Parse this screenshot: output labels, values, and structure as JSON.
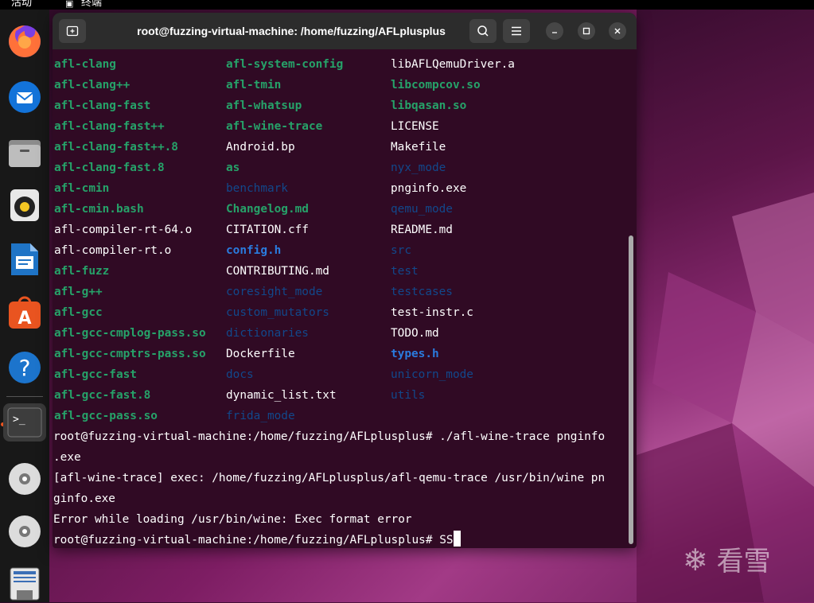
{
  "topbar": {
    "activities": "活动",
    "app_name": "终端"
  },
  "dock": {
    "items": [
      "firefox-icon",
      "thunderbird-icon",
      "files-icon",
      "rhythmbox-icon",
      "writer-icon",
      "app-center-icon",
      "help-icon",
      "terminal-icon",
      "disc-icon",
      "disc-icon",
      "save-icon"
    ]
  },
  "window": {
    "title": "root@fuzzing-virtual-machine: /home/fuzzing/AFLplusplus"
  },
  "listing": [
    [
      {
        "t": "afl-clang",
        "k": "exe"
      },
      {
        "t": "afl-system-config",
        "k": "exe"
      },
      {
        "t": "libAFLQemuDriver.a",
        "k": "plain"
      }
    ],
    [
      {
        "t": "afl-clang++",
        "k": "exe"
      },
      {
        "t": "afl-tmin",
        "k": "exe"
      },
      {
        "t": "libcompcov.so",
        "k": "exe"
      }
    ],
    [
      {
        "t": "afl-clang-fast",
        "k": "exe"
      },
      {
        "t": "afl-whatsup",
        "k": "exe"
      },
      {
        "t": "libqasan.so",
        "k": "exe"
      }
    ],
    [
      {
        "t": "afl-clang-fast++",
        "k": "exe"
      },
      {
        "t": "afl-wine-trace",
        "k": "exe"
      },
      {
        "t": "LICENSE",
        "k": "plain"
      }
    ],
    [
      {
        "t": "afl-clang-fast++.8",
        "k": "exe"
      },
      {
        "t": "Android.bp",
        "k": "plain"
      },
      {
        "t": "Makefile",
        "k": "plain"
      }
    ],
    [
      {
        "t": "afl-clang-fast.8",
        "k": "exe"
      },
      {
        "t": "as",
        "k": "exe"
      },
      {
        "t": "nyx_mode",
        "k": "dir"
      }
    ],
    [
      {
        "t": "afl-cmin",
        "k": "exe"
      },
      {
        "t": "benchmark",
        "k": "dir"
      },
      {
        "t": "pnginfo.exe",
        "k": "plain"
      }
    ],
    [
      {
        "t": "afl-cmin.bash",
        "k": "exe"
      },
      {
        "t": "Changelog.md",
        "k": "exe"
      },
      {
        "t": "qemu_mode",
        "k": "dir"
      }
    ],
    [
      {
        "t": "afl-compiler-rt-64.o",
        "k": "plain"
      },
      {
        "t": "CITATION.cff",
        "k": "plain"
      },
      {
        "t": "README.md",
        "k": "plain"
      }
    ],
    [
      {
        "t": "afl-compiler-rt.o",
        "k": "plain"
      },
      {
        "t": "config.h",
        "k": "hdr"
      },
      {
        "t": "src",
        "k": "dir"
      }
    ],
    [
      {
        "t": "afl-fuzz",
        "k": "exe"
      },
      {
        "t": "CONTRIBUTING.md",
        "k": "plain"
      },
      {
        "t": "test",
        "k": "dir"
      }
    ],
    [
      {
        "t": "afl-g++",
        "k": "exe"
      },
      {
        "t": "coresight_mode",
        "k": "dir"
      },
      {
        "t": "testcases",
        "k": "dir"
      }
    ],
    [
      {
        "t": "afl-gcc",
        "k": "exe"
      },
      {
        "t": "custom_mutators",
        "k": "dir"
      },
      {
        "t": "test-instr.c",
        "k": "plain"
      }
    ],
    [
      {
        "t": "afl-gcc-cmplog-pass.so",
        "k": "exe"
      },
      {
        "t": "dictionaries",
        "k": "dir"
      },
      {
        "t": "TODO.md",
        "k": "plain"
      }
    ],
    [
      {
        "t": "afl-gcc-cmptrs-pass.so",
        "k": "exe"
      },
      {
        "t": "Dockerfile",
        "k": "plain"
      },
      {
        "t": "types.h",
        "k": "hdr"
      }
    ],
    [
      {
        "t": "afl-gcc-fast",
        "k": "exe"
      },
      {
        "t": "docs",
        "k": "dir"
      },
      {
        "t": "unicorn_mode",
        "k": "dir"
      }
    ],
    [
      {
        "t": "afl-gcc-fast.8",
        "k": "exe"
      },
      {
        "t": "dynamic_list.txt",
        "k": "plain"
      },
      {
        "t": "utils",
        "k": "dir"
      }
    ],
    [
      {
        "t": "afl-gcc-pass.so",
        "k": "exe"
      },
      {
        "t": "frida_mode",
        "k": "dir"
      },
      {
        "t": "",
        "k": "plain"
      }
    ]
  ],
  "output_lines": [
    "root@fuzzing-virtual-machine:/home/fuzzing/AFLplusplus# ./afl-wine-trace pnginfo",
    ".exe",
    "[afl-wine-trace] exec: /home/fuzzing/AFLplusplus/afl-qemu-trace /usr/bin/wine pn",
    "ginfo.exe",
    "Error while loading /usr/bin/wine: Exec format error"
  ],
  "prompt": "root@fuzzing-virtual-machine:/home/fuzzing/AFLplusplus# ",
  "typed_input": "SS",
  "watermark": "看雪",
  "colors": {
    "exe": "#26a269",
    "dir": "#12488b",
    "header": "#2a7bde",
    "terminal_bg": "#300a24"
  }
}
